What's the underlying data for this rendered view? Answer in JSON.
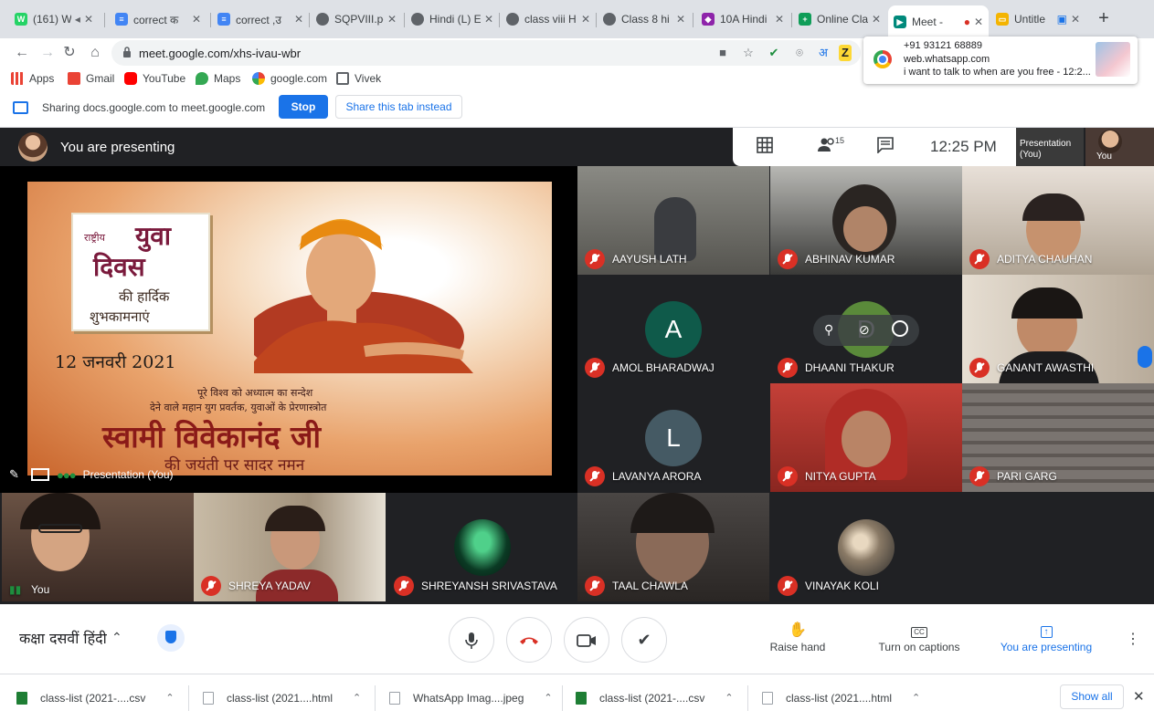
{
  "browser": {
    "tabs": [
      {
        "title": "(161) W",
        "fav": "#25d366",
        "glyph": "W"
      },
      {
        "title": "correct क",
        "fav": "#4285f4",
        "glyph": "≡"
      },
      {
        "title": "correct ,उ",
        "fav": "#4285f4",
        "glyph": "≡"
      },
      {
        "title": "SQPVIII.pc",
        "fav": "#5f6368",
        "glyph": "◎"
      },
      {
        "title": "Hindi (L) E",
        "fav": "#5f6368",
        "glyph": "◎"
      },
      {
        "title": "class viii H",
        "fav": "#5f6368",
        "glyph": "◎"
      },
      {
        "title": "Class 8 hi",
        "fav": "#5f6368",
        "glyph": "◎"
      },
      {
        "title": "10A Hindi",
        "fav": "#8e24aa",
        "glyph": "◆"
      },
      {
        "title": "Online Cla",
        "fav": "#0f9d58",
        "glyph": "+"
      },
      {
        "title": "Meet -",
        "fav": "#00897b",
        "glyph": "▶"
      },
      {
        "title": "Untitle",
        "fav": "#f4b400",
        "glyph": "▭"
      }
    ],
    "url": "meet.google.com/xhs-ivau-wbr",
    "new_tab": "+",
    "bookmarks": [
      {
        "label": "Apps",
        "color": "#4285f4"
      },
      {
        "label": "Gmail",
        "color": "#ea4335"
      },
      {
        "label": "YouTube",
        "color": "#ff0000"
      },
      {
        "label": "Maps",
        "color": "#34a853"
      },
      {
        "label": "google.com",
        "color": "#4285f4"
      },
      {
        "label": "Vivek",
        "color": "#5f6368"
      }
    ],
    "omnibox_char": "अ"
  },
  "notification": {
    "line1": "+91 93121 68889",
    "line2": "web.whatsapp.com",
    "line3": "i want to talk to when are you free - 12:2..."
  },
  "sharing": {
    "text": "Sharing docs.google.com to meet.google.com",
    "stop_label": "Stop",
    "share_tab_label": "Share this tab instead"
  },
  "meet": {
    "presenting_label": "You are presenting",
    "participant_count": "15",
    "clock": "12:25 PM",
    "mini_presentation": "Presentation (You)",
    "mini_you": "You",
    "slide": {
      "rashtriya": "राष्ट्रीय",
      "yuva": "युवा",
      "diwas": "दिवस",
      "hardik": "की हार्दिक",
      "shubh": "शुभकामनाएं",
      "date": "12 जनवरी 2021",
      "line1": "पूरे विश्व को अध्यात्म का सन्देश",
      "line2": "देने वाले महान युग प्रवर्तक, युवाओं के प्रेरणास्त्रोत",
      "name": "स्वामी विवेकानंद जी",
      "jayanti": "की जयंती पर सादर नमन"
    },
    "slide_caption": "Presentation (You)",
    "participants": [
      {
        "name": "AAYUSH LATH",
        "bg": "#6b6a64"
      },
      {
        "name": "ABHINAV KUMAR",
        "bg": "#4a4a48"
      },
      {
        "name": "ADITYA CHAUHAN",
        "bg": "#8a847c"
      },
      {
        "name": "AMOL BHARADWAJ",
        "initial": "A",
        "avatar": "#0f5a4a"
      },
      {
        "name": "DHAANI THAKUR",
        "initial": "D",
        "avatar": "#5a8a3a"
      },
      {
        "name": "GANANT AWASTHI",
        "bg": "#7d7063"
      },
      {
        "name": "LAVANYA ARORA",
        "initial": "L",
        "avatar": "#455a64"
      },
      {
        "name": "NITYA GUPTA",
        "bg": "#a8302a"
      },
      {
        "name": "PARI GARG",
        "bg": "#6c6660"
      },
      {
        "name": "You",
        "bg": "#5a4236"
      },
      {
        "name": "SHREYA YADAV",
        "bg": "#8c8070"
      },
      {
        "name": "SHREYANSH SRIVASTAVA",
        "avatar": "#0b3a24"
      },
      {
        "name": "TAAL CHAWLA",
        "bg": "#3a3634"
      },
      {
        "name": "VINAYAK KOLI",
        "avatar": "#8a7a66"
      }
    ]
  },
  "controls": {
    "meeting_title": "कक्षा दसवीं हिंदी",
    "raise_hand": "Raise hand",
    "captions": "Turn on captions",
    "presenting": "You are presenting"
  },
  "downloads": {
    "items": [
      {
        "name": "class-list (2021-....csv",
        "color": "#1e7e34"
      },
      {
        "name": "class-list (2021....html",
        "color": "#9aa0a6"
      },
      {
        "name": "WhatsApp Imag....jpeg",
        "color": "#9aa0a6"
      },
      {
        "name": "class-list (2021-....csv",
        "color": "#1e7e34"
      },
      {
        "name": "class-list (2021....html",
        "color": "#9aa0a6"
      }
    ],
    "show_all": "Show all"
  },
  "colors": {
    "accent": "#1a73e8",
    "meet_bg": "#202124",
    "mute_red": "#d93025"
  }
}
